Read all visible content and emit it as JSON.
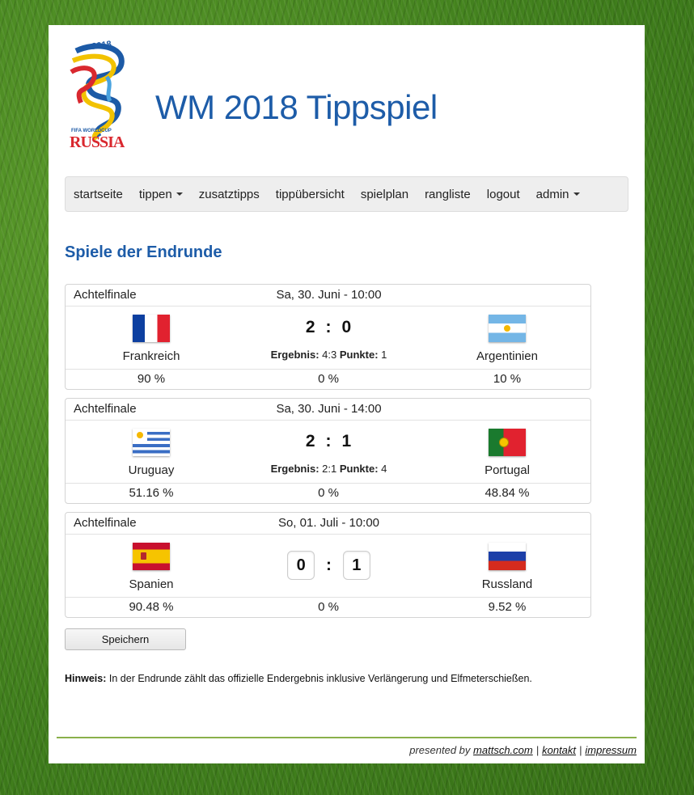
{
  "header": {
    "title": "WM 2018 Tippspiel",
    "logo_year": "2018",
    "logo_subtitle": "FIFA WORLDCUP",
    "logo_country": "RUSSIA"
  },
  "nav": {
    "items": [
      "startseite",
      "tippen",
      "zusatztipps",
      "tippübersicht",
      "spielplan",
      "rangliste",
      "logout",
      "admin"
    ]
  },
  "page_title": "Spiele der Endrunde",
  "matches": [
    {
      "round": "Achtelfinale",
      "date": "Sa, 30. Juni - 10:00",
      "home": {
        "name": "Frankreich",
        "pct": "90 %"
      },
      "away": {
        "name": "Argentinien",
        "pct": "10 %"
      },
      "score_home": "2",
      "score_away": "0",
      "result_label": "Ergebnis:",
      "result_value": "4:3",
      "points_label": "Punkte:",
      "points_value": "1",
      "draw_pct": "0 %"
    },
    {
      "round": "Achtelfinale",
      "date": "Sa, 30. Juni - 14:00",
      "home": {
        "name": "Uruguay",
        "pct": "51.16 %"
      },
      "away": {
        "name": "Portugal",
        "pct": "48.84 %"
      },
      "score_home": "2",
      "score_away": "1",
      "result_label": "Ergebnis:",
      "result_value": "2:1",
      "points_label": "Punkte:",
      "points_value": "4",
      "draw_pct": "0 %"
    },
    {
      "round": "Achtelfinale",
      "date": "So, 01. Juli - 10:00",
      "home": {
        "name": "Spanien",
        "pct": "90.48 %"
      },
      "away": {
        "name": "Russland",
        "pct": "9.52 %"
      },
      "input_home": "0",
      "input_away": "1",
      "draw_pct": "0 %"
    }
  ],
  "score_separator": ":",
  "save_label": "Speichern",
  "hint": {
    "label": "Hinweis:",
    "text": "In der Endrunde zählt das offizielle Endergebnis inklusive Verlängerung und Elfmeterschießen."
  },
  "footer": {
    "presented_by": "presented by",
    "link1": "mattsch.com",
    "link2": "kontakt",
    "link3": "impressum",
    "sep": "|"
  },
  "colors": {
    "title_blue": "#1d5ca8",
    "footer_line": "#8ab04a"
  }
}
